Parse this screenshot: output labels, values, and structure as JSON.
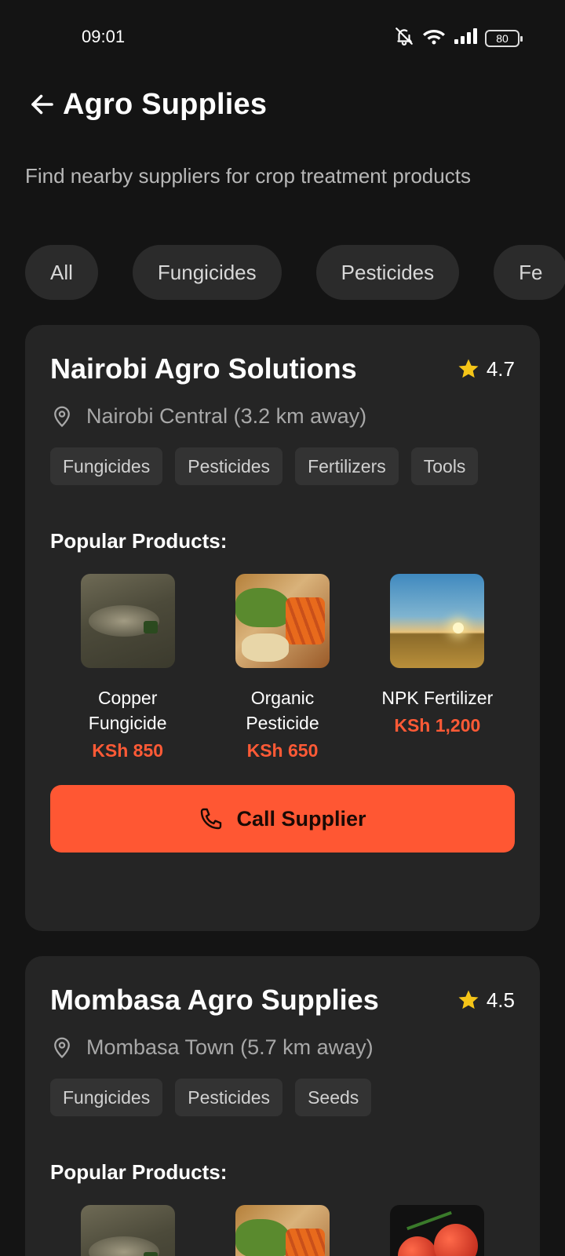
{
  "status_bar": {
    "time": "09:01",
    "battery": "80",
    "icons": [
      "mute-icon",
      "wifi-icon",
      "signal-icon",
      "battery-icon"
    ]
  },
  "header": {
    "title": "Agro Supplies",
    "back_icon": "arrow-left-icon"
  },
  "subtitle": "Find nearby suppliers for crop treatment products",
  "filters": [
    {
      "label": "All"
    },
    {
      "label": "Fungicides"
    },
    {
      "label": "Pesticides"
    },
    {
      "label": "Fe"
    }
  ],
  "suppliers": [
    {
      "name": "Nairobi Agro Solutions",
      "rating": "4.7",
      "location": "Nairobi Central (3.2 km away)",
      "tags": [
        "Fungicides",
        "Pesticides",
        "Fertilizers",
        "Tools"
      ],
      "section_label": "Popular Products:",
      "products": [
        {
          "name": "Copper Fungicide",
          "price": "KSh 850",
          "image": "field-spraying"
        },
        {
          "name": "Organic Pesticide",
          "price": "KSh 650",
          "image": "vegetables"
        },
        {
          "name": "NPK Fertilizer",
          "price": "KSh 1,200",
          "image": "sunset-field"
        }
      ],
      "call_label": "Call Supplier"
    },
    {
      "name": "Mombasa Agro Supplies",
      "rating": "4.5",
      "location": "Mombasa Town (5.7 km away)",
      "tags": [
        "Fungicides",
        "Pesticides",
        "Seeds"
      ],
      "section_label": "Popular Products:",
      "products": [
        {
          "image": "field-spraying"
        },
        {
          "image": "vegetables"
        },
        {
          "image": "tomatoes"
        }
      ]
    }
  ],
  "colors": {
    "background": "#141414",
    "card": "#252525",
    "accent": "#ff5733",
    "price": "#ff5a36",
    "star": "#f5c518"
  }
}
